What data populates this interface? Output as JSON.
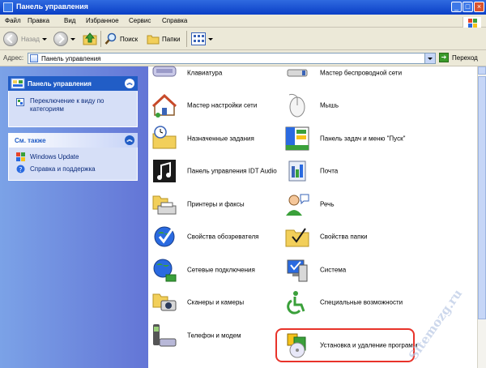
{
  "window": {
    "title": "Панель управления"
  },
  "menu": [
    "Файл",
    "Правка",
    "Вид",
    "Избранное",
    "Сервис",
    "Справка"
  ],
  "toolbar": {
    "back_label": "Назад",
    "search_label": "Поиск",
    "folders_label": "Папки"
  },
  "address": {
    "label": "Адрес:",
    "value": "Панель управления",
    "go_label": "Переход"
  },
  "sidebar": {
    "panel1": {
      "title": "Панель управления",
      "link": "Переключение к виду по категориям"
    },
    "panel2": {
      "title": "См. также",
      "links": [
        "Windows Update",
        "Справка и поддержка"
      ]
    }
  },
  "items": [
    {
      "label": "Клавиатура",
      "icon": "keyboard-icon"
    },
    {
      "label": "Мастер беспроводной сети",
      "icon": "wireless-network-icon"
    },
    {
      "label": "Мастер настройки сети",
      "icon": "network-setup-icon"
    },
    {
      "label": "Мышь",
      "icon": "mouse-icon"
    },
    {
      "label": "Назначенные задания",
      "icon": "scheduled-tasks-icon"
    },
    {
      "label": "Панель задач и меню \"Пуск\"",
      "icon": "taskbar-icon"
    },
    {
      "label": "Панель управления IDT Audio",
      "icon": "audio-icon"
    },
    {
      "label": "Почта",
      "icon": "mail-icon"
    },
    {
      "label": "Принтеры и факсы",
      "icon": "printer-icon"
    },
    {
      "label": "Речь",
      "icon": "speech-icon"
    },
    {
      "label": "Свойства обозревателя",
      "icon": "internet-options-icon"
    },
    {
      "label": "Свойства папки",
      "icon": "folder-options-icon"
    },
    {
      "label": "Сетевые подключения",
      "icon": "network-connections-icon"
    },
    {
      "label": "Система",
      "icon": "system-icon"
    },
    {
      "label": "Сканеры и камеры",
      "icon": "scanner-icon"
    },
    {
      "label": "Специальные возможности",
      "icon": "accessibility-icon"
    },
    {
      "label": "Телефон и модем",
      "icon": "phone-modem-icon"
    },
    {
      "label": "Установка и удаление программ",
      "icon": "add-remove-programs-icon"
    }
  ],
  "watermark": "Sitemozg.ru"
}
